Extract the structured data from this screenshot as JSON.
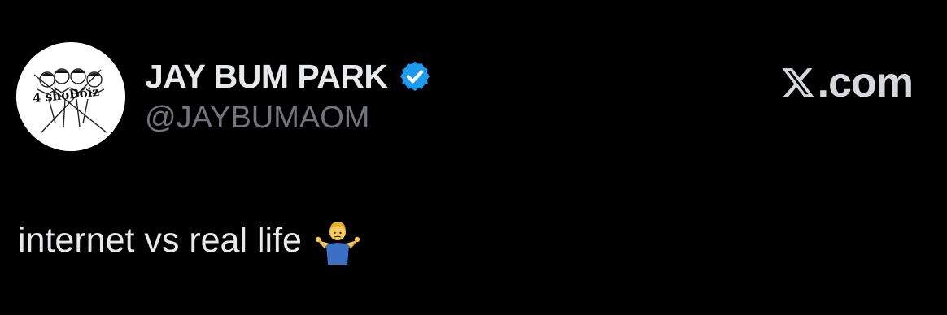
{
  "author": {
    "display_name": "JAY BUM PARK",
    "handle": "@JAYBUMAOM",
    "verified": true,
    "avatar_text": "4 shoBoiz"
  },
  "brand": {
    "site_suffix": ".com",
    "logo_icon": "x-logo-icon"
  },
  "tweet": {
    "text": "internet vs real life",
    "emoji_icon": "person-shrugging-icon"
  },
  "colors": {
    "background": "#000000",
    "name": "#e7e9ea",
    "handle": "#71767b",
    "verified_badge": "#1d9bf0"
  }
}
